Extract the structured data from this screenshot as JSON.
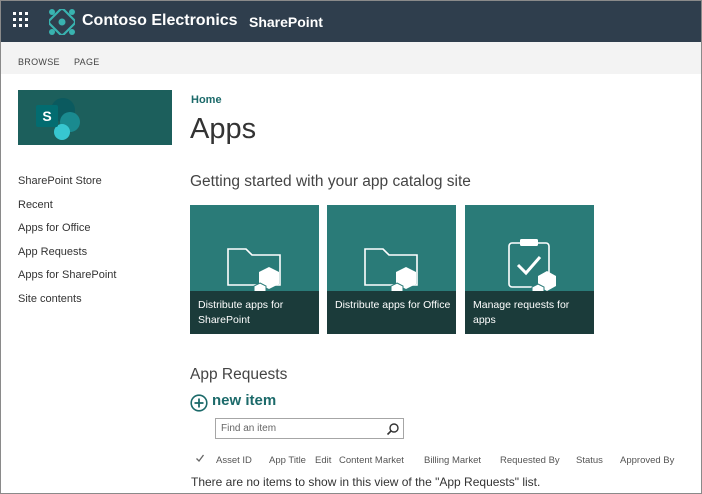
{
  "suite_bar": {
    "brand": "Contoso Electronics",
    "app_name": "SharePoint"
  },
  "ribbon": {
    "tabs": [
      "BROWSE",
      "PAGE"
    ]
  },
  "left_nav": {
    "items": [
      "SharePoint Store",
      "Recent",
      "Apps for Office",
      "App Requests",
      "Apps for SharePoint",
      "Site contents"
    ]
  },
  "breadcrumb": "Home",
  "page_title": "Apps",
  "getting_started": {
    "heading": "Getting started with your app catalog site",
    "tiles": [
      {
        "label": "Distribute apps for SharePoint",
        "icon": "folder-apps-icon"
      },
      {
        "label": "Distribute apps for Office",
        "icon": "folder-apps-icon"
      },
      {
        "label": "Manage requests for apps",
        "icon": "clipboard-check-icon"
      }
    ]
  },
  "app_requests": {
    "title": "App Requests",
    "new_item_label": "new item",
    "search_placeholder": "Find an item",
    "columns": [
      "Asset ID",
      "App Title",
      "Edit",
      "Content Market",
      "Billing Market",
      "Requested By",
      "Status",
      "Approved By"
    ],
    "empty_message": "There are no items to show in this view of the \"App Requests\" list."
  },
  "colors": {
    "suite_bar": "#2f3e4d",
    "tile": "#2a7b78",
    "tile_band": "#1b3b3a",
    "accent": "#1c6a6a"
  }
}
